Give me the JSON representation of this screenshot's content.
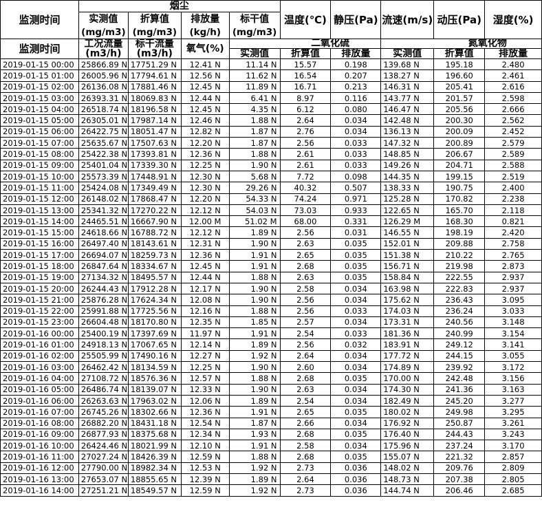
{
  "header": {
    "group_dust": "烟尘",
    "col_time": "监测时间",
    "measured_value": "实测值",
    "unit_mg": "(mg/m3)",
    "converted_value": "折算值",
    "emission": "排放量",
    "unit_kgh": "(kg/h)",
    "std_dry_value": "标干值",
    "temperature": "温度(℃)",
    "static_pressure": "静压(Pa)",
    "flow_speed": "流速(m/s)",
    "dynamic_pressure": "动压(Pa)",
    "humidity": "湿度(%)",
    "col_time2": "监测时间",
    "work_flow": "工况流量",
    "std_flow": "标干流量",
    "unit_m3h": "(m3/h)",
    "oxygen": "氧气(%)",
    "group_so2": "二氧化硫",
    "group_nox": "氮氧化物",
    "so2_measured": "实测值",
    "so2_converted": "折算值",
    "so2_emission": "排放量",
    "nox_measured": "实测值",
    "nox_converted": "折算值",
    "nox_emission": "排放量"
  },
  "rows": [
    [
      "2019-01-15 00:00",
      "25866.89 N",
      "17751.29 N",
      "12.41 N",
      "11.14 N",
      "15.57",
      "0.198",
      "139.68 N",
      "195.18",
      "2.480"
    ],
    [
      "2019-01-15 01:00",
      "26005.96 N",
      "17794.61 N",
      "12.56 N",
      "11.62 N",
      "16.54",
      "0.207",
      "138.27 N",
      "196.60",
      "2.461"
    ],
    [
      "2019-01-15 02:00",
      "26136.08 N",
      "17881.46 N",
      "12.45 N",
      "11.89 N",
      "16.71",
      "0.213",
      "146.31 N",
      "205.41",
      "2.616"
    ],
    [
      "2019-01-15 03:00",
      "26393.31 N",
      "18069.83 N",
      "12.44 N",
      "6.41 N",
      "8.97",
      "0.116",
      "143.77 N",
      "201.57",
      "2.598"
    ],
    [
      "2019-01-15 04:00",
      "26518.74 N",
      "18196.58 N",
      "12.45 N",
      "4.35 N",
      "6.12",
      "0.080",
      "146.47 N",
      "205.56",
      "2.666"
    ],
    [
      "2019-01-15 05:00",
      "26305.01 N",
      "17987.14 N",
      "12.46 N",
      "1.88 N",
      "2.64",
      "0.034",
      "142.48 N",
      "200.30",
      "2.562"
    ],
    [
      "2019-01-15 06:00",
      "26422.75 N",
      "18051.47 N",
      "12.82 N",
      "1.87 N",
      "2.76",
      "0.034",
      "136.13 N",
      "200.09",
      "2.452"
    ],
    [
      "2019-01-15 07:00",
      "25635.67 N",
      "17507.63 N",
      "12.20 N",
      "1.87 N",
      "2.56",
      "0.033",
      "147.32 N",
      "200.89",
      "2.579"
    ],
    [
      "2019-01-15 08:00",
      "25422.38 N",
      "17393.81 N",
      "12.36 N",
      "1.88 N",
      "2.61",
      "0.033",
      "148.85 N",
      "206.67",
      "2.589"
    ],
    [
      "2019-01-15 09:00",
      "25401.04 N",
      "17339.30 N",
      "12.25 N",
      "1.90 N",
      "2.61",
      "0.033",
      "149.26 N",
      "204.71",
      "2.588"
    ],
    [
      "2019-01-15 10:00",
      "25573.39 N",
      "17448.91 N",
      "12.30 N",
      "5.68 N",
      "7.72",
      "0.098",
      "144.35 N",
      "199.15",
      "2.519"
    ],
    [
      "2019-01-15 11:00",
      "25424.08 N",
      "17349.49 N",
      "12.30 N",
      "29.26 N",
      "40.32",
      "0.507",
      "138.33 N",
      "190.75",
      "2.400"
    ],
    [
      "2019-01-15 12:00",
      "26148.02 N",
      "17868.47 N",
      "12.20 N",
      "54.33 N",
      "74.24",
      "0.971",
      "125.28 N",
      "170.82",
      "2.238"
    ],
    [
      "2019-01-15 13:00",
      "25341.32 N",
      "17270.22 N",
      "12.12 N",
      "54.03 N",
      "73.03",
      "0.933",
      "122.65 N",
      "165.70",
      "2.118"
    ],
    [
      "2019-01-15 14:00",
      "24465.51 N",
      "16667.90 N",
      "12.00 M",
      "51.02 M",
      "68.00",
      "0.331",
      "126.29 M",
      "168.30",
      "0.821"
    ],
    [
      "2019-01-15 15:00",
      "24618.66 N",
      "16788.72 N",
      "12.12 N",
      "1.89 N",
      "2.56",
      "0.031",
      "146.55 N",
      "198.19",
      "2.420"
    ],
    [
      "2019-01-15 16:00",
      "26497.40 N",
      "18143.61 N",
      "12.31 N",
      "1.90 N",
      "2.63",
      "0.035",
      "152.01 N",
      "209.88",
      "2.758"
    ],
    [
      "2019-01-15 17:00",
      "26694.07 N",
      "18259.73 N",
      "12.36 N",
      "1.91 N",
      "2.65",
      "0.035",
      "151.38 N",
      "210.22",
      "2.765"
    ],
    [
      "2019-01-15 18:00",
      "26847.64 N",
      "18334.67 N",
      "12.45 N",
      "1.91 N",
      "2.68",
      "0.035",
      "156.71 N",
      "219.98",
      "2.873"
    ],
    [
      "2019-01-15 19:00",
      "27134.32 N",
      "18495.57 N",
      "12.44 N",
      "1.88 N",
      "2.63",
      "0.035",
      "158.84 N",
      "222.55",
      "2.937"
    ],
    [
      "2019-01-15 20:00",
      "26244.43 N",
      "17912.28 N",
      "12.17 N",
      "1.90 N",
      "2.58",
      "0.034",
      "163.98 N",
      "222.83",
      "2.937"
    ],
    [
      "2019-01-15 21:00",
      "25876.28 N",
      "17624.34 N",
      "12.08 N",
      "1.90 N",
      "2.56",
      "0.034",
      "175.62 N",
      "236.43",
      "3.095"
    ],
    [
      "2019-01-15 22:00",
      "25991.88 N",
      "17725.56 N",
      "12.16 N",
      "1.88 N",
      "2.56",
      "0.033",
      "174.03 N",
      "236.24",
      "3.033"
    ],
    [
      "2019-01-15 23:00",
      "26604.48 N",
      "18170.80 N",
      "12.35 N",
      "1.85 N",
      "2.57",
      "0.034",
      "173.31 N",
      "240.56",
      "3.148"
    ],
    [
      "2019-01-16 00:00",
      "25400.19 N",
      "17397.69 N",
      "11.97 N",
      "1.91 N",
      "2.54",
      "0.033",
      "181.36 N",
      "240.99",
      "3.154"
    ],
    [
      "2019-01-16 01:00",
      "24918.13 N",
      "17067.65 N",
      "12.14 N",
      "1.89 N",
      "2.56",
      "0.032",
      "183.91 N",
      "249.12",
      "3.141"
    ],
    [
      "2019-01-16 02:00",
      "25505.99 N",
      "17490.16 N",
      "12.27 N",
      "1.92 N",
      "2.64",
      "0.034",
      "177.72 N",
      "244.15",
      "3.055"
    ],
    [
      "2019-01-16 03:00",
      "26462.42 N",
      "18134.59 N",
      "12.25 N",
      "1.90 N",
      "2.60",
      "0.034",
      "174.89 N",
      "239.92",
      "3.172"
    ],
    [
      "2019-01-16 04:00",
      "27108.72 N",
      "18576.36 N",
      "12.57 N",
      "1.88 N",
      "2.68",
      "0.035",
      "170.00 N",
      "242.48",
      "3.156"
    ],
    [
      "2019-01-16 05:00",
      "26486.74 N",
      "18139.07 N",
      "12.33 N",
      "1.90 N",
      "2.63",
      "0.034",
      "174.30 N",
      "241.36",
      "3.163"
    ],
    [
      "2019-01-16 06:00",
      "26263.63 N",
      "17963.02 N",
      "12.06 N",
      "1.89 N",
      "2.54",
      "0.034",
      "182.49 N",
      "245.20",
      "3.277"
    ],
    [
      "2019-01-16 07:00",
      "26745.26 N",
      "18302.66 N",
      "12.36 N",
      "1.91 N",
      "2.65",
      "0.035",
      "180.02 N",
      "249.98",
      "3.295"
    ],
    [
      "2019-01-16 08:00",
      "26882.20 N",
      "18431.18 N",
      "12.54 N",
      "1.87 N",
      "2.66",
      "0.034",
      "176.92 N",
      "250.87",
      "3.261"
    ],
    [
      "2019-01-16 09:00",
      "26877.93 N",
      "18375.68 N",
      "12.34 N",
      "1.93 N",
      "2.68",
      "0.035",
      "176.40 N",
      "244.43",
      "3.243"
    ],
    [
      "2019-01-16 10:00",
      "26424.46 N",
      "18021.99 N",
      "12.10 N",
      "1.91 N",
      "2.58",
      "0.034",
      "175.96 N",
      "237.24",
      "3.170"
    ],
    [
      "2019-01-16 11:00",
      "27027.24 N",
      "18426.39 N",
      "12.59 N",
      "1.88 N",
      "2.68",
      "0.035",
      "155.07 N",
      "221.32",
      "2.857"
    ],
    [
      "2019-01-16 12:00",
      "27790.00 N",
      "18982.34 N",
      "12.53 N",
      "1.92 N",
      "2.73",
      "0.036",
      "148.02 N",
      "209.76",
      "2.809"
    ],
    [
      "2019-01-16 13:00",
      "27653.07 N",
      "18855.65 N",
      "12.39 N",
      "1.89 N",
      "2.64",
      "0.036",
      "148.73 N",
      "207.38",
      "2.805"
    ],
    [
      "2019-01-16 14:00",
      "27251.21 N",
      "18549.57 N",
      "12.59 N",
      "1.92 N",
      "2.73",
      "0.036",
      "144.74 N",
      "206.46",
      "2.685"
    ]
  ]
}
